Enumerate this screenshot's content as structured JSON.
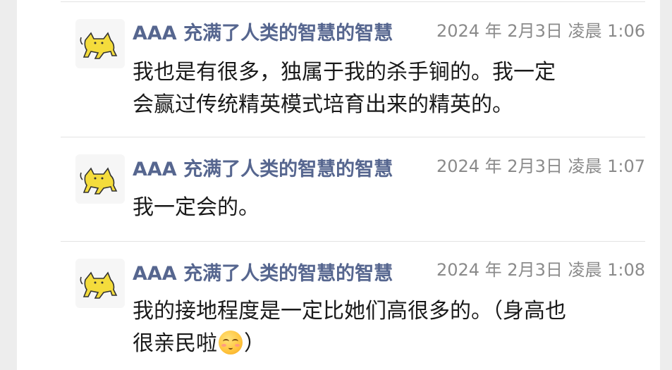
{
  "messages": [
    {
      "sender": "AAA 充满了人类的智慧的智慧",
      "time": "2024 年 2月3日 凌晨 1:06",
      "lines": [
        "我也是有很多，独属于我的杀手锏的。我一定",
        "会赢过传统精英模式培育出来的精英的。"
      ]
    },
    {
      "sender": "AAA 充满了人类的智慧的智慧",
      "time": "2024 年 2月3日 凌晨 1:07",
      "lines": [
        "我一定会的。"
      ]
    },
    {
      "sender": "AAA 充满了人类的智慧的智慧",
      "time": "2024 年 2月3日 凌晨 1:08",
      "lines": [
        "我的接地程度是一定比她们高很多的。（身高也",
        "很亲民啦"
      ],
      "line2_suffix": "）",
      "emoji": "blushing-smile-emoji"
    }
  ],
  "colors": {
    "background": "#ededed",
    "panel": "#ffffff",
    "sender": "#56668f",
    "time": "#8a8a8a",
    "text": "#1a1a1a",
    "avatar_cat": "#f4dc3c"
  },
  "icons": {
    "avatar": "yellow-cat-avatar-icon"
  }
}
